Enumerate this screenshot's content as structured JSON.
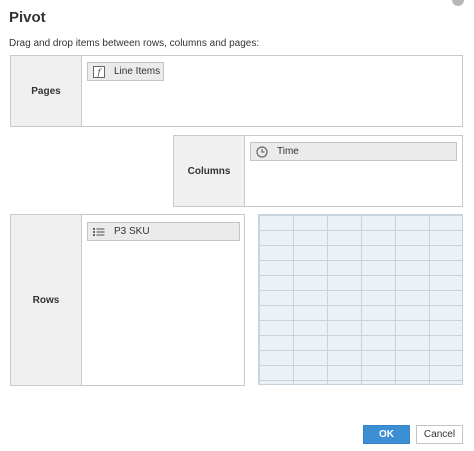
{
  "dialog": {
    "title": "Pivot",
    "instructions": "Drag and drop items between rows, columns and pages:"
  },
  "zones": {
    "pages": {
      "label": "Pages",
      "items": [
        {
          "label": "Line Items",
          "icon": "formula-icon"
        }
      ]
    },
    "columns": {
      "label": "Columns",
      "items": [
        {
          "label": "Time",
          "icon": "clock-icon"
        }
      ]
    },
    "rows": {
      "label": "Rows",
      "items": [
        {
          "label": "P3 SKU",
          "icon": "list-icon"
        }
      ]
    }
  },
  "buttons": {
    "ok_label": "OK",
    "cancel_label": "Cancel"
  },
  "colors": {
    "accent": "#3d8fd4",
    "label_background": "#f0f0f0",
    "grid_background": "#eaf1f7"
  }
}
